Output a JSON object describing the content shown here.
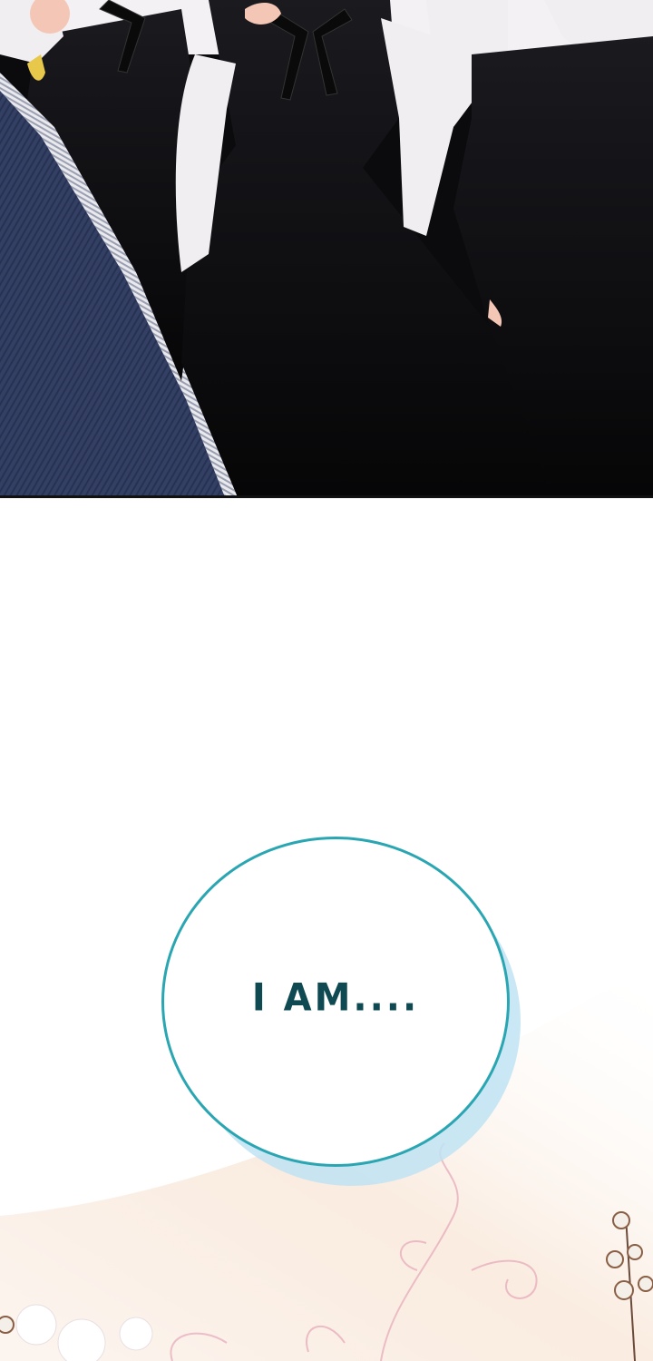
{
  "panels": {
    "top": {},
    "bubble": {
      "text": "I AM...."
    }
  },
  "colors": {
    "dress": "#0b0b0d",
    "sleeve": "#f1eef2",
    "coat": "#2f3a5c",
    "bubble_outline": "#2aa6b2",
    "bubble_shadow": "#bfe3f3",
    "bubble_text": "#0f4a52",
    "floral_accent": "#e8b0bf"
  }
}
